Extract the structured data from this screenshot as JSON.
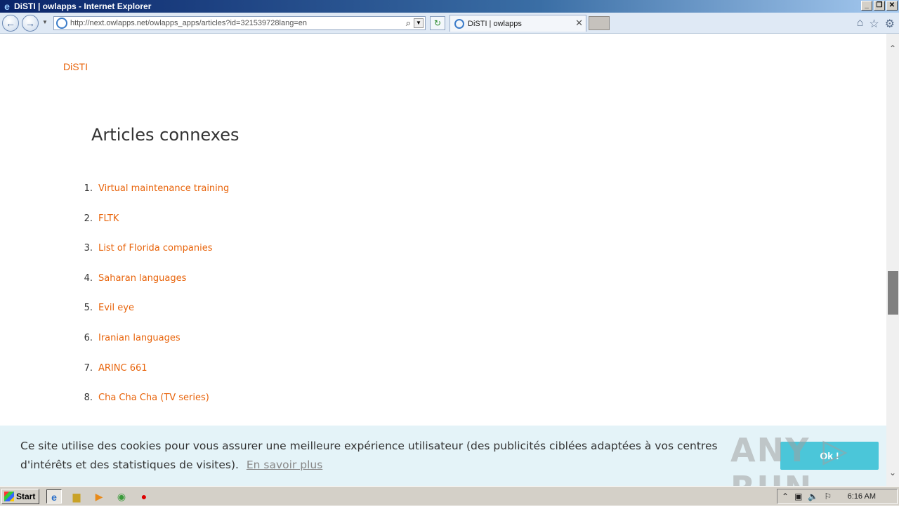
{
  "window": {
    "title": "DiSTI | owlapps - Internet Explorer",
    "controls": [
      "_",
      "❐",
      "✕"
    ]
  },
  "nav": {
    "url": "http://next.owlapps.net/owlapps_apps/articles?id=321539728lang=en",
    "tab_title": "DiSTI | owlapps",
    "icons": [
      "back-icon",
      "forward-icon",
      "refresh-icon",
      "home-icon",
      "star-icon",
      "gear-icon"
    ]
  },
  "page": {
    "brand": "DiSTI",
    "section_title": "Articles connexes",
    "articles": [
      {
        "num": "1.",
        "title": "Virtual maintenance training"
      },
      {
        "num": "2.",
        "title": "FLTK"
      },
      {
        "num": "3.",
        "title": "List of Florida companies"
      },
      {
        "num": "4.",
        "title": "Saharan languages"
      },
      {
        "num": "5.",
        "title": "Evil eye"
      },
      {
        "num": "6.",
        "title": "Iranian languages"
      },
      {
        "num": "7.",
        "title": "ARINC 661"
      },
      {
        "num": "8.",
        "title": "Cha Cha Cha (TV series)"
      }
    ],
    "link_color": "#e8630a"
  },
  "cookie": {
    "text": "Ce site utilise des cookies pour vous assurer une meilleure expérience utilisateur (des publicités ciblées adaptées à vos centres d'intérêts et des statistiques de visites).",
    "link": "En savoir plus",
    "button": "Ok !",
    "watermark": "ANY ▷ RUN"
  },
  "taskbar": {
    "start": "Start",
    "clock": "6:16 AM"
  }
}
